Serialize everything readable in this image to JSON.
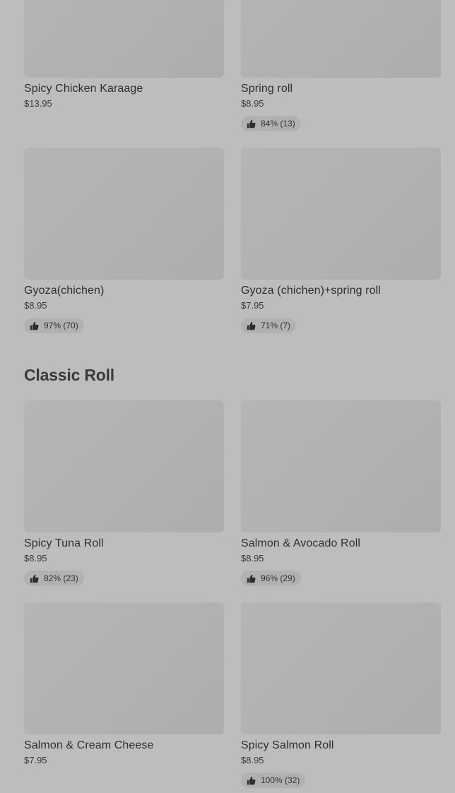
{
  "top_items": [
    {
      "name": "Spicy Chicken Karaage",
      "price": "$13.95",
      "rating": ""
    },
    {
      "name": "Spring roll",
      "price": "$8.95",
      "rating": "84% (13)"
    },
    {
      "name": "Gyoza(chichen)",
      "price": "$8.95",
      "rating": "97% (70)"
    },
    {
      "name": "Gyoza (chichen)+spring roll",
      "price": "$7.95",
      "rating": "71% (7)"
    }
  ],
  "section": {
    "title": "Classic Roll"
  },
  "classic_items": [
    {
      "name": "Spicy Tuna Roll",
      "price": "$8.95",
      "rating": "82% (23)"
    },
    {
      "name": "Salmon & Avocado Roll",
      "price": "$8.95",
      "rating": "96% (29)"
    },
    {
      "name": "Salmon & Cream Cheese",
      "price": "$7.95",
      "rating": ""
    },
    {
      "name": "Spicy Salmon Roll",
      "price": "$8.95",
      "rating": "100% (32)"
    }
  ],
  "icons": {
    "rating": "thumbs-up-icon"
  },
  "colors": {
    "background": "#bdbdbd",
    "image_placeholder": "#b1b1b1",
    "badge": "#b1b1b1"
  }
}
